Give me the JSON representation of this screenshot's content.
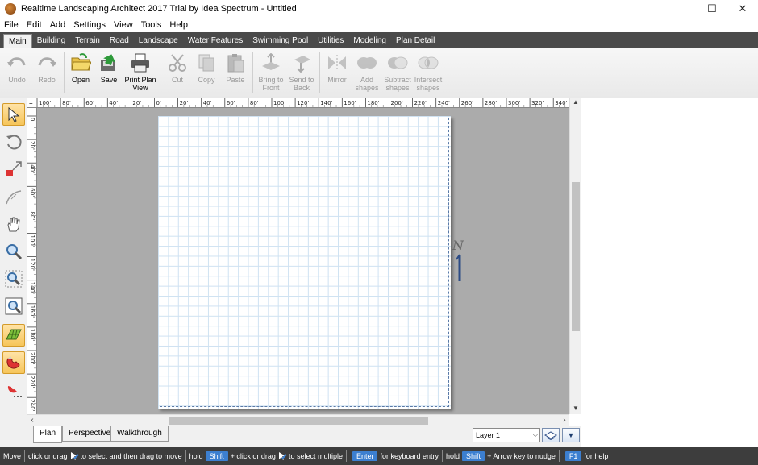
{
  "window": {
    "title": "Realtime Landscaping Architect 2017 Trial by Idea Spectrum - Untitled",
    "minimize": "—",
    "maximize": "☐",
    "close": "✕"
  },
  "menu": [
    "File",
    "Edit",
    "Add",
    "Settings",
    "View",
    "Tools",
    "Help"
  ],
  "ribbon_tabs": [
    {
      "label": "Main",
      "active": true
    },
    {
      "label": "Building"
    },
    {
      "label": "Terrain"
    },
    {
      "label": "Road"
    },
    {
      "label": "Landscape"
    },
    {
      "label": "Water Features"
    },
    {
      "label": "Swimming Pool"
    },
    {
      "label": "Utilities"
    },
    {
      "label": "Modeling"
    },
    {
      "label": "Plan Detail"
    }
  ],
  "toolbar": {
    "undo": "Undo",
    "redo": "Redo",
    "open": "Open",
    "save": "Save",
    "print_line1": "Print Plan",
    "print_line2": "View",
    "cut": "Cut",
    "copy": "Copy",
    "paste": "Paste",
    "front_line1": "Bring to",
    "front_line2": "Front",
    "back_line1": "Send to",
    "back_line2": "Back",
    "mirror": "Mirror",
    "add_line1": "Add",
    "add_line2": "shapes",
    "subtract_line1": "Subtract",
    "subtract_line2": "shapes",
    "intersect_line1": "Intersect",
    "intersect_line2": "shapes"
  },
  "ruler_top": [
    "100'",
    "80'",
    "60'",
    "40'",
    "20'",
    "0'",
    "20'",
    "40'",
    "60'",
    "80'",
    "100'",
    "120'",
    "140'",
    "160'",
    "180'",
    "200'",
    "220'",
    "240'",
    "260'",
    "280'",
    "300'",
    "320'",
    "340'"
  ],
  "ruler_left": [
    "0'",
    "20'",
    "40'",
    "60'",
    "80'",
    "100'",
    "120'",
    "140'",
    "160'",
    "180'",
    "200'",
    "220'",
    "240'"
  ],
  "compass_label": "N",
  "view_tabs": [
    {
      "label": "Plan",
      "active": true
    },
    {
      "label": "Perspective"
    },
    {
      "label": "Walkthrough"
    }
  ],
  "layer": {
    "selected": "Layer 1"
  },
  "status": {
    "mode": "Move",
    "p1": "click or drag",
    "p2": "to select and then drag to move",
    "hold1": "hold",
    "shift1": "Shift",
    "p3": "+ click or drag",
    "p4": "to select multiple",
    "enter": "Enter",
    "p5": "for keyboard entry",
    "hold2": "hold",
    "shift2": "Shift",
    "p6": "+ Arrow key to nudge",
    "f1": "F1",
    "p7": "for help"
  },
  "colors": {
    "accent": "#3c7fd0",
    "tabstrip": "#4a4a4a",
    "canvas": "#ababab",
    "grid": "#cfe2f2",
    "selected_tool": "#f6c55a"
  }
}
